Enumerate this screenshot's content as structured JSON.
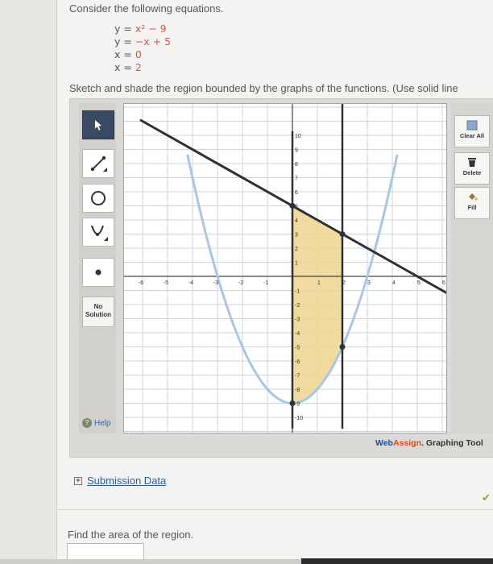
{
  "question": {
    "intro": "Consider the following equations.",
    "equations": [
      {
        "lhs": "y",
        "rhs": "x² − 9"
      },
      {
        "lhs": "y",
        "rhs": "−x + 5"
      },
      {
        "lhs": "x",
        "rhs": "0"
      },
      {
        "lhs": "x",
        "rhs": "2"
      }
    ],
    "instruction": "Sketch and shade the region bounded by the graphs of the functions. (Use solid line"
  },
  "toolbar": {
    "tools": [
      {
        "name": "pointer",
        "icon": "arrow-pointer-icon",
        "active": true
      },
      {
        "name": "line",
        "icon": "line-tool-icon"
      },
      {
        "name": "circle",
        "icon": "circle-tool-icon"
      },
      {
        "name": "parabola",
        "icon": "parabola-tool-icon"
      },
      {
        "name": "point",
        "icon": "point-tool-icon"
      }
    ],
    "no_solution_label": "No Solution",
    "help_label": "Help"
  },
  "right_tools": {
    "clear_all": "Clear All",
    "delete": "Delete",
    "fill": "Fill"
  },
  "graph": {
    "x_ticks": [
      "-6",
      "-5",
      "-4",
      "-3",
      "-2",
      "-1",
      "1",
      "2",
      "3",
      "4",
      "5",
      "6"
    ],
    "y_ticks": [
      "10",
      "9",
      "8",
      "7",
      "6",
      "5",
      "4",
      "3",
      "2",
      "1",
      "-1",
      "-2",
      "-3",
      "-4",
      "-5",
      "-6",
      "-7",
      "-8",
      "-9",
      "-10"
    ],
    "colors": {
      "parabola": "#a9c6e3",
      "line": "#2e3136",
      "shade": "#f0d58f",
      "grid": "#cfd3d8"
    }
  },
  "brand": {
    "web": "Web",
    "assign": "Assign",
    "suffix": ". Graphing Tool"
  },
  "submission_label": "Submission Data",
  "find_area": "Find the area of the region."
}
